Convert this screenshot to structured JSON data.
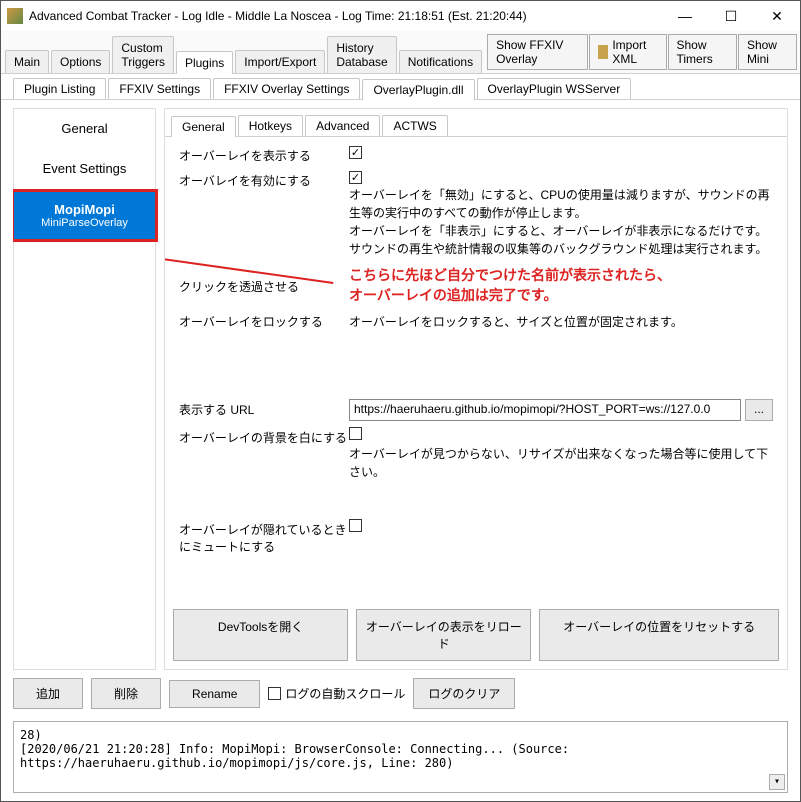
{
  "titlebar": {
    "title": "Advanced Combat Tracker - Log Idle - Middle La Noscea - Log Time: 21:18:51 (Est. 21:20:44)"
  },
  "main_tabs": [
    "Main",
    "Options",
    "Custom Triggers",
    "Plugins",
    "Import/Export",
    "History Database",
    "Notifications"
  ],
  "main_tab_active": 3,
  "right_buttons": {
    "show_overlay": "Show FFXIV Overlay",
    "import_xml": "Import XML",
    "show_timers": "Show Timers",
    "show_mini": "Show Mini"
  },
  "sub_tabs": [
    "Plugin Listing",
    "FFXIV Settings",
    "FFXIV Overlay Settings",
    "OverlayPlugin.dll",
    "OverlayPlugin WSServer"
  ],
  "sub_tab_active": 3,
  "left_panel": {
    "general": "General",
    "event_settings": "Event Settings",
    "selected_title": "MopiMopi",
    "selected_sub": "MiniParseOverlay"
  },
  "inner_tabs": [
    "General",
    "Hotkeys",
    "Advanced",
    "ACTWS"
  ],
  "inner_tab_active": 0,
  "form": {
    "show_overlay": {
      "label": "オーバーレイを表示する",
      "checked": "✓"
    },
    "enable_overlay": {
      "label": "オーバレイを有効にする",
      "checked": "✓",
      "desc": "オーバーレイを「無効」にすると、CPUの使用量は減りますが、サウンドの再生等の実行中のすべての動作が停止します。\nオーバーレイを「非表示」にすると、オーバーレイが非表示になるだけです。サウンドの再生や統計情報の収集等のバックグラウンド処理は実行されます。"
    },
    "click_through": {
      "label": "クリックを透過させる"
    },
    "lock_overlay": {
      "label": "オーバーレイをロックする",
      "desc": "オーバーレイをロックすると、サイズと位置が固定されます。"
    },
    "url": {
      "label": "表示する URL",
      "value": "https://haeruhaeru.github.io/mopimopi/?HOST_PORT=ws://127.0.0"
    },
    "white_bg": {
      "label": "オーバーレイの背景を白にする",
      "desc": "オーバーレイが見つからない、リサイズが出来なくなった場合等に使用して下さい。"
    },
    "mute_hidden": {
      "label": "オーバーレイが隠れているときにミュートにする"
    }
  },
  "annotation": {
    "line1": "こちらに先ほど自分でつけた名前が表示されたら、",
    "line2": "オーバーレイの追加は完了です。"
  },
  "bottom_buttons": {
    "devtools": "DevToolsを開く",
    "reload": "オーバーレイの表示をリロード",
    "reset_pos": "オーバーレイの位置をリセットする"
  },
  "ctrl": {
    "add": "追加",
    "delete": "削除",
    "rename": "Rename",
    "autoscroll": "ログの自動スクロール",
    "clear_log": "ログのクリア"
  },
  "log_text": "28)\n[2020/06/21 21:20:28] Info: MopiMopi: BrowserConsole: Connecting... (Source: https://haeruhaeru.github.io/mopimopi/js/core.js, Line: 280)"
}
